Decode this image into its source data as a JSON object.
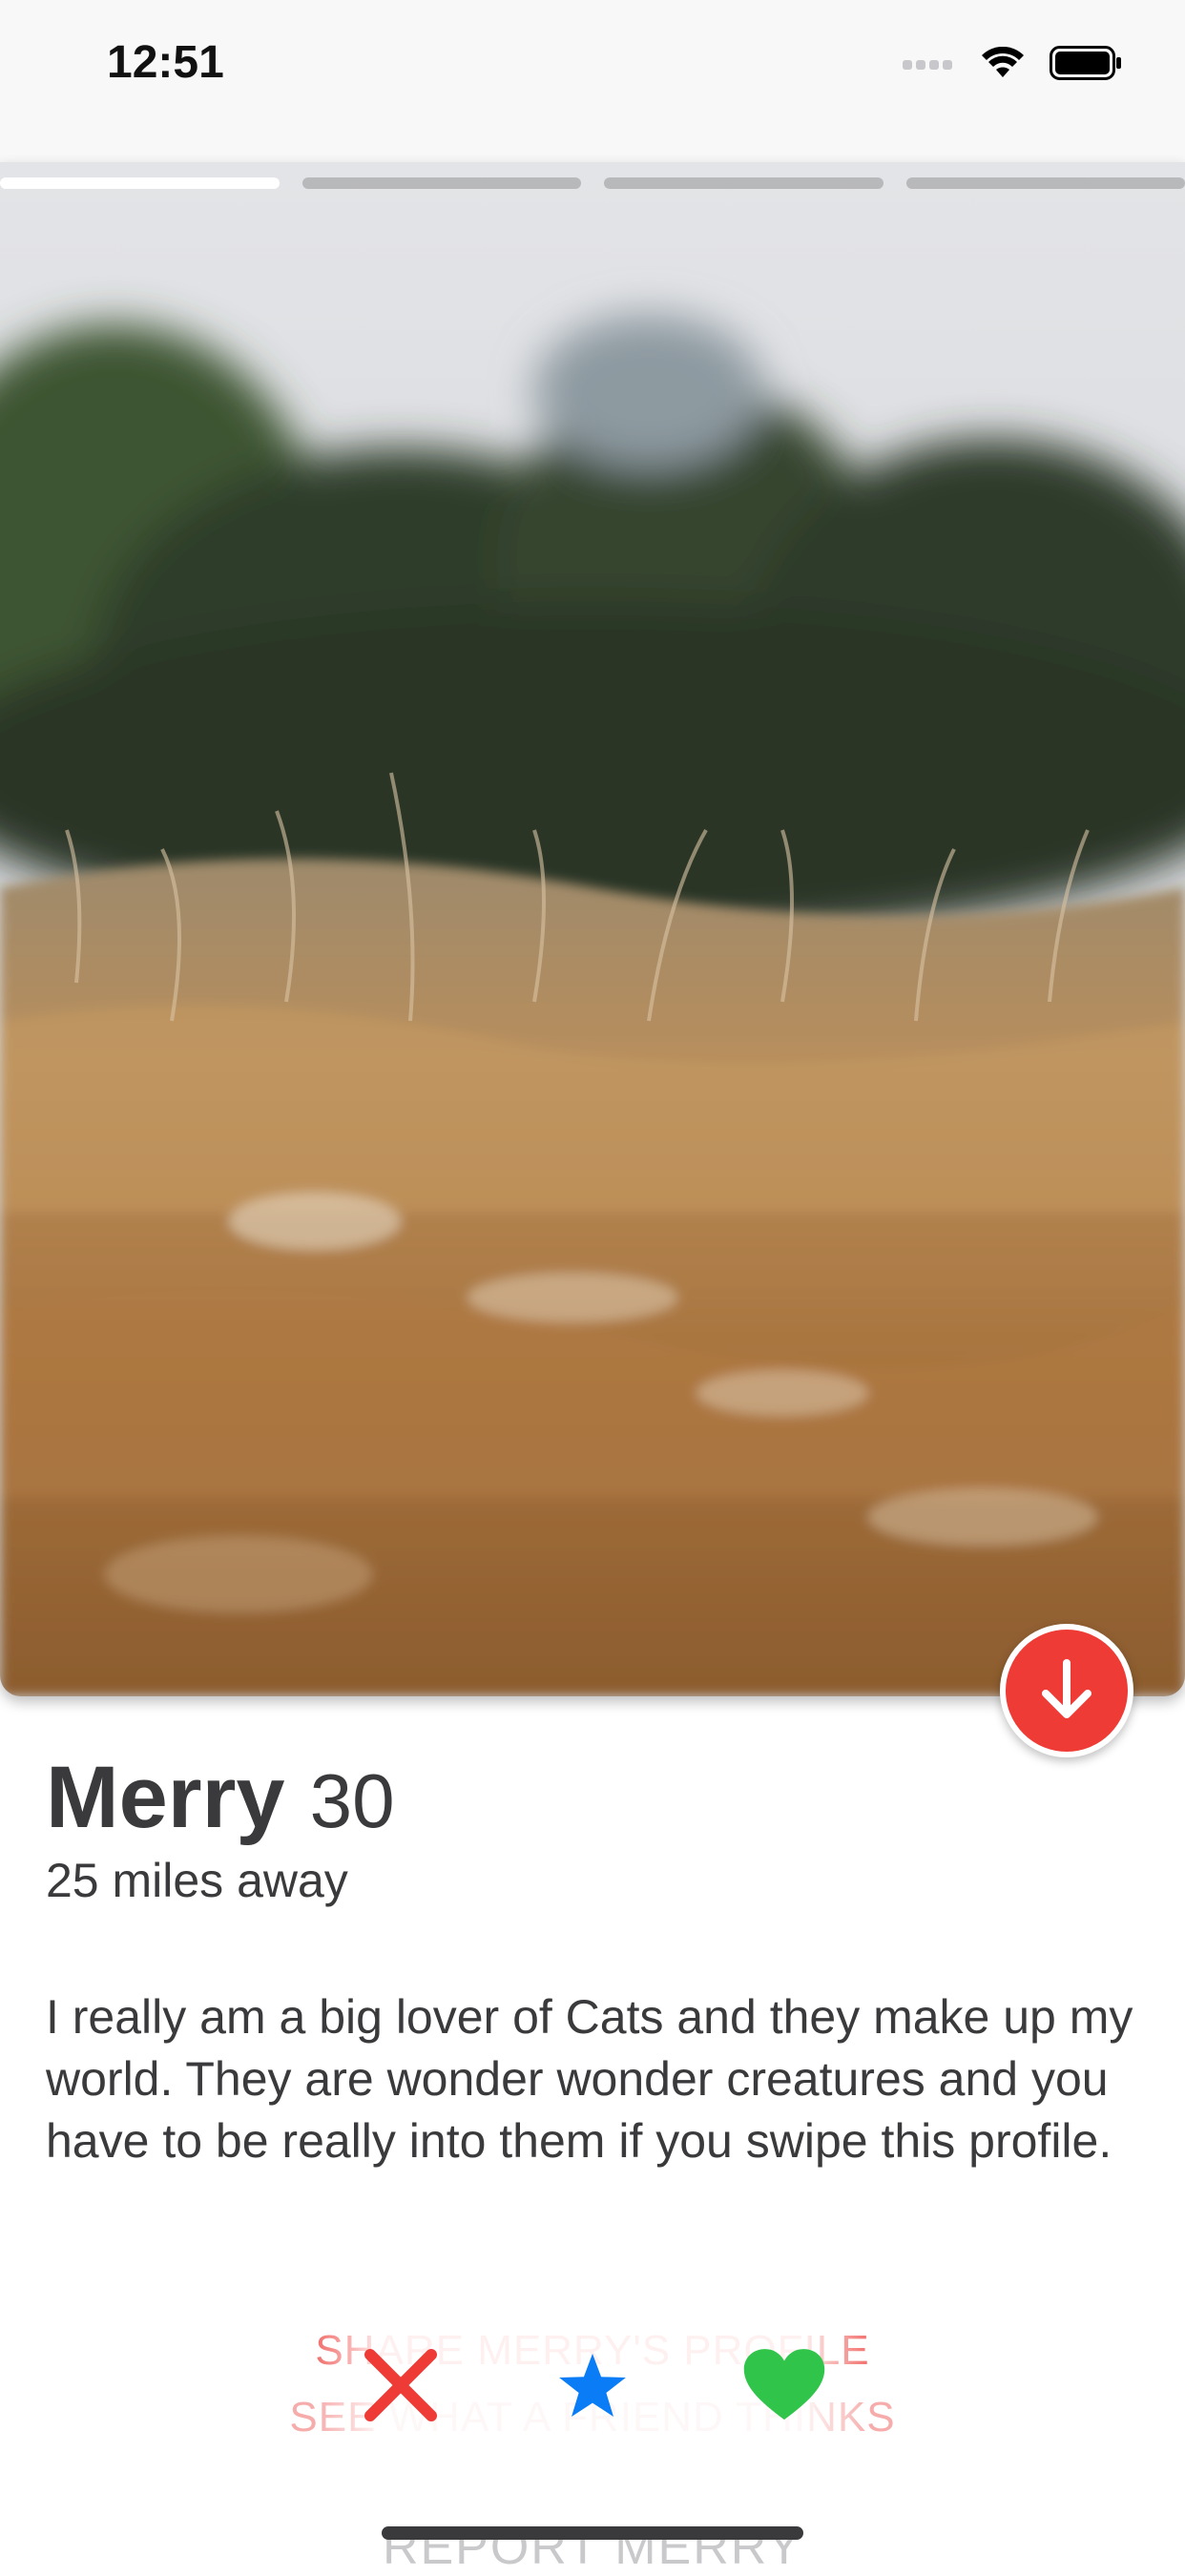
{
  "status_bar": {
    "time": "12:51"
  },
  "profile": {
    "photo_pages": 4,
    "active_photo": 1,
    "name": "Merry",
    "age": "30",
    "distance": "25 miles away",
    "bio": "I really am a big lover of Cats and they make up my world. They are wonder wonder creatures and you have to be really into them if you swipe this profile."
  },
  "behind_actions": {
    "line1": "SHARE MERRY'S PROFILE",
    "line2": "SEE WHAT A FRIEND THINKS"
  },
  "actions": {
    "dislike_icon": "x-icon",
    "superlike_icon": "star-icon",
    "like_icon": "heart-icon"
  },
  "report": {
    "label": "REPORT MERRY"
  },
  "colors": {
    "accent_red": "#ef3b36",
    "star_blue": "#0a7cf6",
    "heart_green": "#30c54a",
    "text": "#3a3a3c"
  }
}
